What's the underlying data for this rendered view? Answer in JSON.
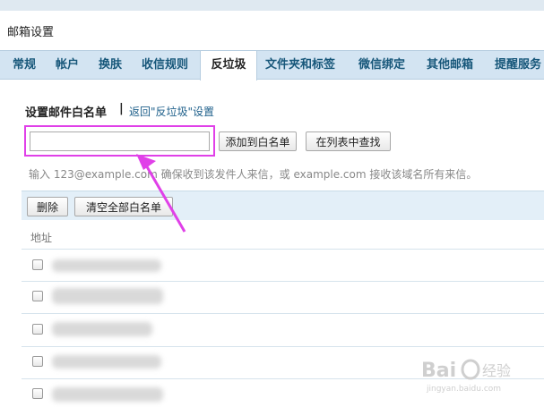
{
  "window": {
    "title": "邮箱设置"
  },
  "tabs": [
    {
      "label": "常规",
      "active": false
    },
    {
      "label": "帐户",
      "active": false
    },
    {
      "label": "换肤",
      "active": false
    },
    {
      "label": "收信规则",
      "active": false
    },
    {
      "label": "反垃圾",
      "active": true
    },
    {
      "label": "文件夹和标签",
      "active": false
    },
    {
      "label": "微信绑定",
      "active": false
    },
    {
      "label": "其他邮箱",
      "active": false
    },
    {
      "label": "提醒服务",
      "active": false
    }
  ],
  "whitelist": {
    "section_title": "设置邮件白名单",
    "separator": "|",
    "back_link": "返回\"反垃圾\"设置",
    "input_value": "",
    "input_placeholder": "",
    "add_button": "添加到白名单",
    "find_button": "在列表中查找",
    "hint": "输入 123@example.com 确保收到该发件人来信，或 example.com 接收该域名所有来信。"
  },
  "list": {
    "delete_button": "删除",
    "clear_button": "清空全部白名单",
    "column_header": "地址",
    "rows": [
      {
        "checked": false,
        "address_obscured": true
      },
      {
        "checked": false,
        "address_obscured": true
      },
      {
        "checked": false,
        "address_obscured": true
      },
      {
        "checked": false,
        "address_obscured": true
      },
      {
        "checked": false,
        "address_obscured": true
      }
    ]
  },
  "annotation": {
    "highlight_color": "#e040e8"
  },
  "watermark": {
    "brand": "Bai",
    "brand_suffix": "经验",
    "url": "jingyan.baidu.com"
  },
  "colors": {
    "tab_bar": "#d3e4f2",
    "tab_text": "#17577a",
    "link": "#1d5f8a",
    "toolbar": "#e3eff8"
  }
}
